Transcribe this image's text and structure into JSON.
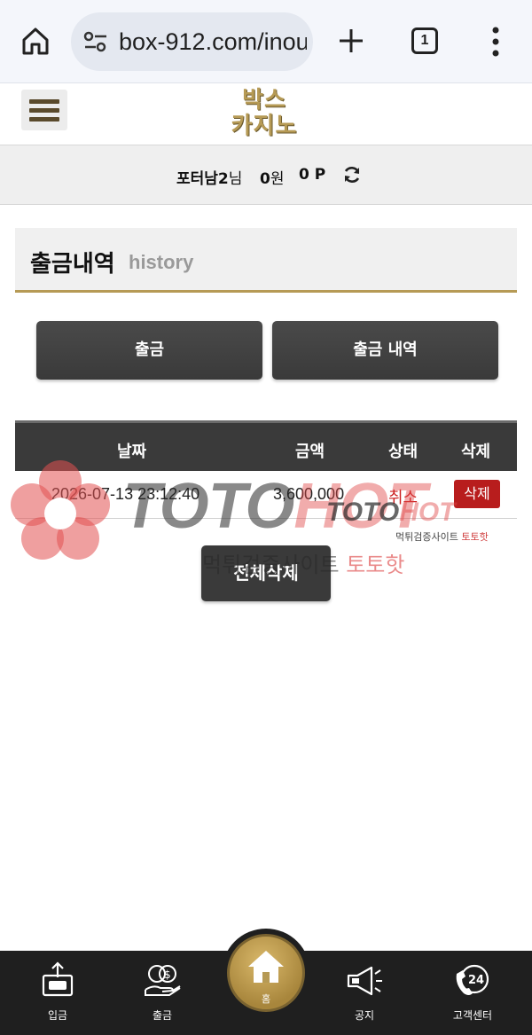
{
  "browser": {
    "url": "box-912.com/inou",
    "tab_count": "1"
  },
  "header": {
    "logo_line1": "박스",
    "logo_line2": "카지노"
  },
  "user": {
    "name": "포터남2",
    "name_suffix": "님",
    "money": "0",
    "money_suffix": "원",
    "points": "0 P"
  },
  "section": {
    "title": "출금내역",
    "subtitle": "history"
  },
  "tabs": {
    "withdraw_label": "출금",
    "history_label": "출금 내역"
  },
  "table": {
    "headers": [
      "날짜",
      "금액",
      "상태",
      "삭제"
    ],
    "rows": [
      {
        "date": "2026-07-13 23:12:40",
        "amount": "3,600,000",
        "status": "취소",
        "delete_label": "삭제"
      }
    ]
  },
  "delete_all_label": "전체삭제",
  "watermark": {
    "brand_a": "TOTO",
    "brand_b": "HOT",
    "tagline_a": "먹튀검증사이트 ",
    "tagline_b": "토토핫"
  },
  "bottom_nav": {
    "deposit": "입금",
    "withdraw": "출금",
    "home": "홈",
    "notice": "공지",
    "support": "고객센터",
    "support_badge": "24"
  },
  "colors": {
    "accent_gold": "#b69a55",
    "delete_red": "#b81d1d",
    "status_red": "#cc2222",
    "dark": "#3a3a3a"
  }
}
